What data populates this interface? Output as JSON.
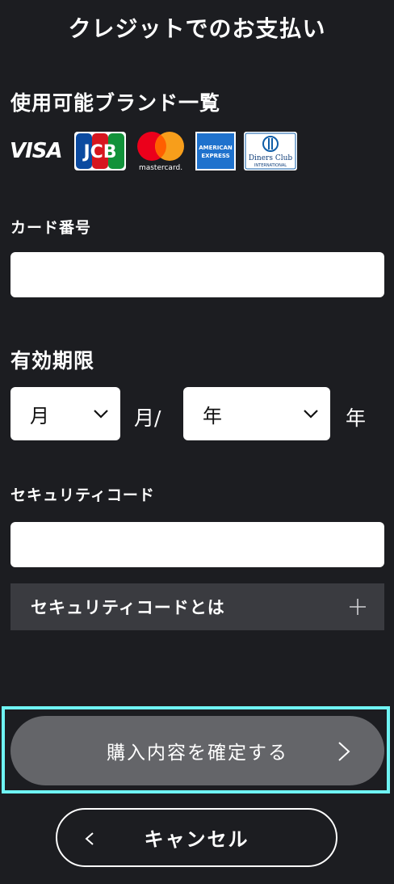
{
  "page": {
    "title": "クレジットでのお支払い"
  },
  "brands": {
    "heading": "使用可能ブランド一覧",
    "items": [
      {
        "name": "VISA",
        "icon": "visa-logo"
      },
      {
        "name": "JCB",
        "icon": "jcb-logo"
      },
      {
        "name": "mastercard",
        "icon": "mastercard-logo"
      },
      {
        "name": "AMERICAN EXPRESS",
        "icon": "amex-logo"
      },
      {
        "name": "Diners Club INTERNATIONAL",
        "icon": "diners-club-logo"
      }
    ],
    "visa_text": "VISA",
    "jcb_text": "JCB",
    "mastercard_text": "mastercard.",
    "amex_line1": "AMERICAN",
    "amex_line2": "EXPRESS",
    "diners_line1": "Diners Club",
    "diners_line2": "INTERNATIONAL"
  },
  "card_number": {
    "label": "カード番号",
    "value": ""
  },
  "expiry": {
    "label": "有効期限",
    "month_value": "月",
    "month_unit": "月/",
    "year_value": "年",
    "year_unit": "年"
  },
  "security_code": {
    "label": "セキュリティコード",
    "value": "",
    "help_label": "セキュリティコードとは",
    "help_icon": "plus-icon"
  },
  "actions": {
    "confirm_label": "購入内容を確定する",
    "cancel_label": "キャンセル"
  },
  "colors": {
    "background": "#1c1d21",
    "accordion": "#3a3b40",
    "confirm_button": "#646569",
    "focus_ring": "#6ff4f4"
  }
}
